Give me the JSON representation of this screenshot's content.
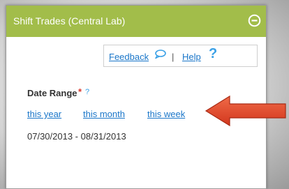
{
  "panel": {
    "title": "Shift Trades (Central Lab)",
    "header_color": "#a2bd4a"
  },
  "links": {
    "feedback": "Feedback",
    "separator": "|",
    "help": "Help",
    "help_icon_glyph": "?"
  },
  "date_range": {
    "label": "Date Range",
    "required_marker": "*",
    "help_marker": "?",
    "quick_links": [
      "this year",
      "this month",
      "this week"
    ],
    "value": "07/30/2013 - 08/31/2013"
  },
  "annotation": {
    "icon": "red-arrow-pointing-left",
    "color": "#e04a2a"
  }
}
